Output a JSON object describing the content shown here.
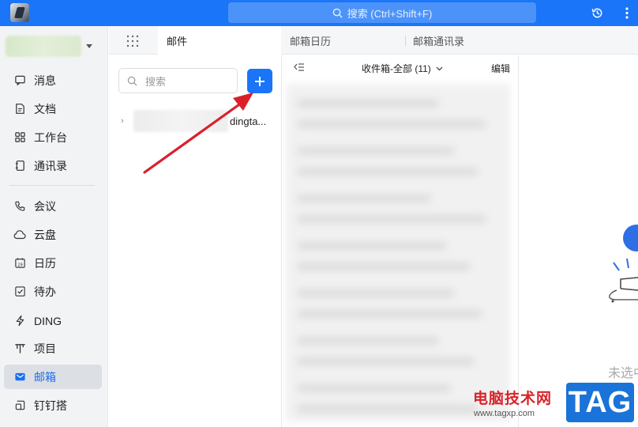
{
  "topbar": {
    "search_placeholder": "搜索 (Ctrl+Shift+F)",
    "accent": "#1a75f8"
  },
  "sidebar": {
    "items": [
      {
        "label": "消息",
        "icon": "message-icon"
      },
      {
        "label": "文档",
        "icon": "document-icon"
      },
      {
        "label": "工作台",
        "icon": "workbench-icon"
      },
      {
        "label": "通讯录",
        "icon": "contacts-icon"
      },
      {
        "label": "会议",
        "icon": "meeting-icon"
      },
      {
        "label": "云盘",
        "icon": "cloud-drive-icon"
      },
      {
        "label": "日历",
        "icon": "calendar-icon"
      },
      {
        "label": "待办",
        "icon": "todo-icon"
      },
      {
        "label": "DING",
        "icon": "ding-icon"
      },
      {
        "label": "项目",
        "icon": "project-icon"
      },
      {
        "label": "邮箱",
        "icon": "mailbox-icon",
        "active": true
      },
      {
        "label": "钉钉搭",
        "icon": "dingda-icon"
      }
    ]
  },
  "tabs": [
    {
      "label": "邮件",
      "active": true
    },
    {
      "label": "邮箱日历"
    },
    {
      "label": "邮箱通讯录"
    }
  ],
  "folders": {
    "search_placeholder": "搜索",
    "account_suffix": "dingta..."
  },
  "msglist": {
    "folder_title": "收件箱-全部 (11)",
    "edit_label": "编辑"
  },
  "reader": {
    "empty_text": "未选中"
  },
  "watermark": {
    "site_name": "电脑技术网",
    "url": "www.tagxp.com",
    "tag": "TAG"
  }
}
